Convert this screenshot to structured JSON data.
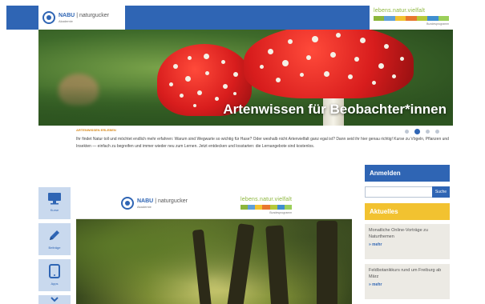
{
  "header": {
    "logo_main": "NABU",
    "logo_main_suffix": "naturgucker",
    "logo_sub": "Akademie",
    "partner_title": "lebens.natur.vielfalt",
    "partner_sub": "Bundesprogramm",
    "partner_bar_colors": [
      "#8cb63c",
      "#5fa0d8",
      "#f2c230",
      "#e8772e",
      "#b6c93a",
      "#3f8ecf",
      "#9bcf5a"
    ]
  },
  "hero": {
    "title": "Artenwissen für Beobachter*innen",
    "slide_count": 4,
    "active_slide": 2
  },
  "intro": {
    "heading": "Artenwissen erleben",
    "text": "Ihr findet Natur toll und möchtet endlich mehr erfahren: Warum sind Wegwarte so wichtig für Hase? Oder weshalb nicht Artenvielfalt ganz egal ist? Dann seid ihr hier genau richtig! Kurse zu Vögeln, Pflanzen und Insekten — einfach zu begreifen und immer wieder neu zum Lernen. Jetzt entdecken und losstarten: die Lernangebote sind kostenlos."
  },
  "side_buttons": [
    {
      "label": "Kurse",
      "icon": "monitor-icon"
    },
    {
      "label": "Beiträge",
      "icon": "pencil-icon"
    },
    {
      "label": "Apps",
      "icon": "tablet-icon"
    },
    {
      "label": "",
      "icon": "chevron-down-icon"
    }
  ],
  "sidebar": {
    "login_label": "Anmelden",
    "search_placeholder": "",
    "search_button": "Suche",
    "news_heading": "Aktuelles",
    "news": [
      {
        "title": "Monatliche Online-Vorträge zu Naturthemen",
        "more": "» mehr"
      },
      {
        "title": "Feldbotanikkurs rund um Freiburg ab März",
        "more": "» mehr"
      }
    ]
  },
  "video": {
    "logo_main": "NABU",
    "logo_suffix": "naturgucker",
    "logo_sub": "Akademie",
    "partner_title": "lebens.natur.vielfalt",
    "partner_sub": "Bundesprogramm"
  },
  "colors": {
    "brand_blue": "#2f65b4",
    "news_yellow": "#f2c230",
    "accent_orange": "#d98a1a"
  }
}
